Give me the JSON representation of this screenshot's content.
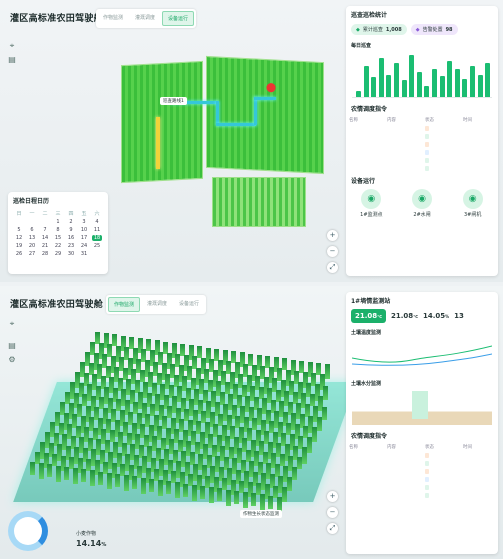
{
  "panel1": {
    "title": "灌区高标准农田驾驶舱",
    "tabs": [
      "作物监测",
      "灌溉调度",
      "设备运行"
    ],
    "active_tab": 2,
    "map_label": "巡查路线1",
    "calendar": {
      "title": "巡检日程日历",
      "weekdays": [
        "日",
        "一",
        "二",
        "三",
        "四",
        "五",
        "六"
      ],
      "days": [
        "",
        "",
        "",
        "1",
        "2",
        "3",
        "4",
        "5",
        "6",
        "7",
        "8",
        "9",
        "10",
        "11",
        "12",
        "13",
        "14",
        "15",
        "16",
        "17",
        "18",
        "19",
        "20",
        "21",
        "22",
        "23",
        "24",
        "25",
        "26",
        "27",
        "28",
        "29",
        "30",
        "31",
        ""
      ],
      "selected": "18"
    },
    "stats": {
      "title": "巡查巡检统计",
      "pill1_label": "累计巡查",
      "pill1_value": "1,008",
      "pill2_label": "告警处置",
      "pill2_value": "98",
      "chart_title": "每日巡查",
      "chart_data": {
        "type": "bar",
        "values": [
          10,
          55,
          35,
          70,
          40,
          60,
          30,
          75,
          45,
          20,
          50,
          38,
          65,
          50,
          32,
          55,
          40,
          60
        ]
      }
    },
    "cmd": {
      "title": "农情调度指令",
      "headers": [
        "名称",
        "内容",
        "状态",
        "时间"
      ],
      "rows": [
        [
          "",
          "",
          "",
          ""
        ],
        [
          "",
          "",
          "",
          ""
        ],
        [
          "",
          "",
          "",
          ""
        ],
        [
          "",
          "",
          "",
          ""
        ],
        [
          "",
          "",
          "",
          ""
        ],
        [
          "",
          "",
          "",
          ""
        ]
      ],
      "tag_colors": [
        "#fde7d6",
        "#dff5ea",
        "#fde7d6",
        "#e1efff",
        "#dff5ea",
        "#dff5ea"
      ]
    },
    "devices": {
      "title": "设备运行",
      "items": [
        {
          "name": "1#监测点"
        },
        {
          "name": "2#水闸"
        },
        {
          "name": "3#闸机"
        }
      ]
    }
  },
  "panel2": {
    "title": "灌区高标准农田驾驶舱",
    "tabs": [
      "作物监测",
      "灌溉调度",
      "设备运行"
    ],
    "active_tab": 0,
    "crop_label": "作物生长状态监测",
    "gauge_label": "",
    "soil": {
      "title": "1#墒情监测站",
      "cards": [
        {
          "label": "",
          "value": "21.08",
          "unit": "℃"
        },
        {
          "value": "21.08",
          "unit": "℃"
        },
        {
          "value": "14.05",
          "unit": "%"
        },
        {
          "value": "13",
          "unit": ""
        }
      ],
      "line_title": "土壤温度监测",
      "bar_title": "土壤水分监测"
    },
    "crop": {
      "name": "小麦作物",
      "value": "14.14",
      "unit": "%"
    },
    "cmd": {
      "title": "农情调度指令",
      "headers": [
        "名称",
        "内容",
        "状态",
        "时间"
      ],
      "rows": [
        [
          "",
          "",
          "",
          ""
        ],
        [
          "",
          "",
          "",
          ""
        ],
        [
          "",
          "",
          "",
          ""
        ],
        [
          "",
          "",
          "",
          ""
        ],
        [
          "",
          "",
          "",
          ""
        ],
        [
          "",
          "",
          "",
          ""
        ]
      ]
    }
  }
}
